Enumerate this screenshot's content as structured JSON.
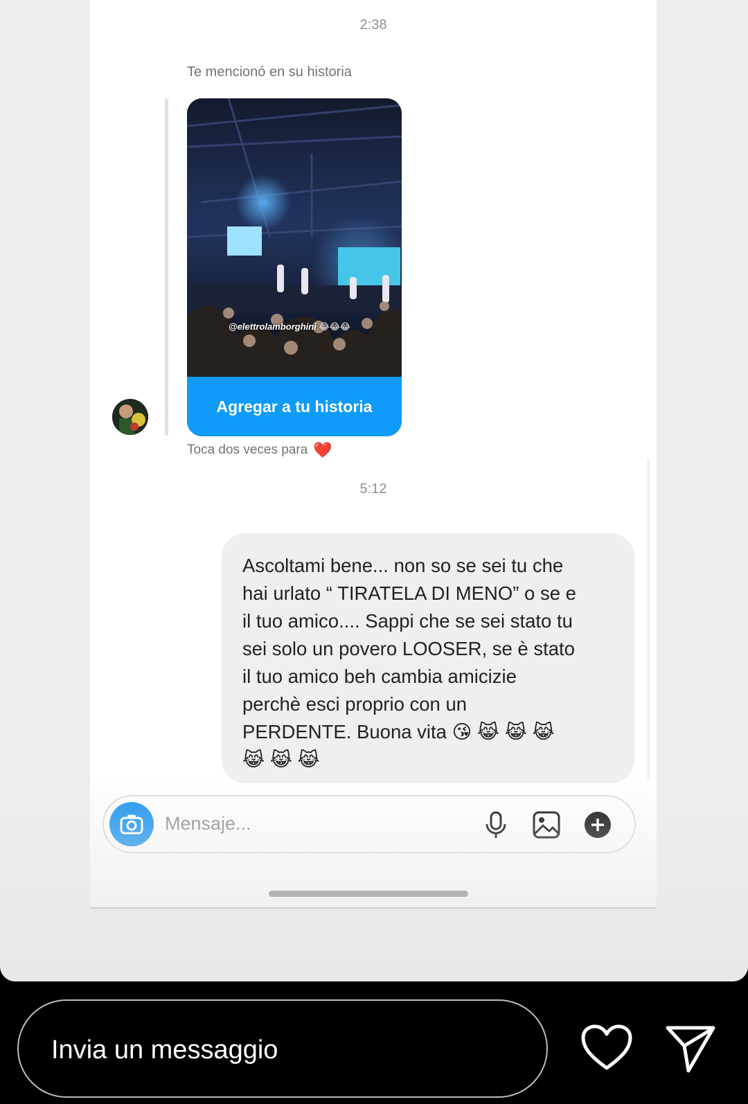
{
  "thread": {
    "timestamp_1": "2:38",
    "mention_text": "Te mencionó en su historia",
    "story_overlay_text": "@elettrolamborghini 😂😂😂",
    "add_story_button": "Agregar a tu historia",
    "double_tap_hint": "Toca dos veces para",
    "heart_emoji": "❤️",
    "timestamp_2": "5:12",
    "message_lines": [
      "Ascoltami bene... non so se sei tu che",
      "hai urlato “ TIRATELA DI MENO” o se e",
      "il tuo amico.... Sappi che se sei stato tu",
      "sei solo un povero LOOSER, se è stato",
      "il tuo amico beh cambia amicizie",
      "perchè esci proprio con un",
      "PERDENTE. Buona vita 😘 😹 😹 😹",
      "😹 😹 😹"
    ]
  },
  "composer": {
    "placeholder": "Mensaje...",
    "icons": [
      "camera-icon",
      "microphone-icon",
      "gallery-icon",
      "plus-icon"
    ]
  },
  "story_reply": {
    "placeholder": "Invia un messaggio",
    "icons": [
      "heart-icon",
      "send-icon"
    ]
  },
  "colors": {
    "accent_blue": "#0f9bf7",
    "bubble_gray": "#efefef",
    "heart_red": "#ed4956"
  }
}
